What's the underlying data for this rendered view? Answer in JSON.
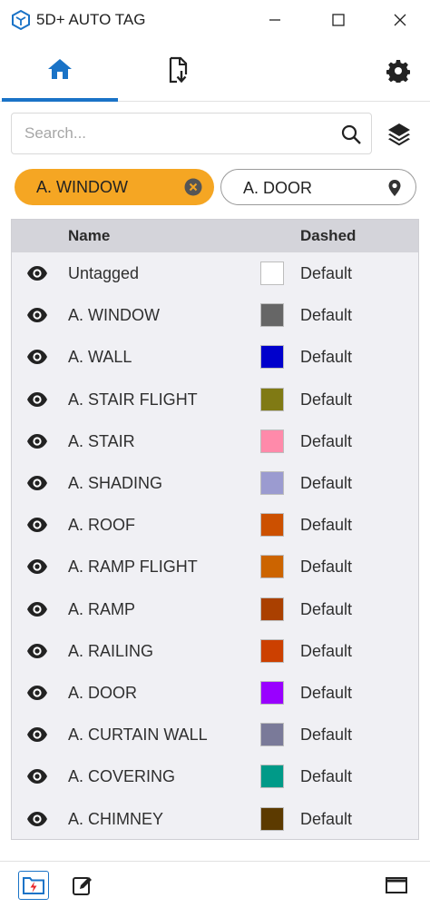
{
  "window": {
    "title": "5D+ AUTO TAG"
  },
  "nav": {
    "tabs": [
      {
        "icon": "home-icon",
        "active": true
      },
      {
        "icon": "import-file-icon",
        "active": false
      }
    ],
    "settings_icon": "gear-icon",
    "accent_color": "#1a73c7"
  },
  "search": {
    "placeholder": "Search...",
    "value": ""
  },
  "filters": {
    "chips": [
      {
        "label": "A. WINDOW",
        "selected": true,
        "color": "#f5a623",
        "icon": "close-circle-icon"
      },
      {
        "label": "A. DOOR",
        "selected": false,
        "color": "#ffffff",
        "icon": "location-pin-icon"
      }
    ]
  },
  "table": {
    "columns": {
      "visibility": "",
      "name": "Name",
      "color": "",
      "dashed": "Dashed"
    },
    "rows": [
      {
        "name": "Untagged",
        "color": "#ffffff",
        "dashed": "Default"
      },
      {
        "name": "A. WINDOW",
        "color": "#666666",
        "dashed": "Default"
      },
      {
        "name": "A. WALL",
        "color": "#0000cc",
        "dashed": "Default"
      },
      {
        "name": "A. STAIR FLIGHT",
        "color": "#807a14",
        "dashed": "Default"
      },
      {
        "name": "A. STAIR",
        "color": "#ff8aaa",
        "dashed": "Default"
      },
      {
        "name": "A. SHADING",
        "color": "#9b9bd0",
        "dashed": "Default"
      },
      {
        "name": "A. ROOF",
        "color": "#cc5000",
        "dashed": "Default"
      },
      {
        "name": "A. RAMP FLIGHT",
        "color": "#cc6400",
        "dashed": "Default"
      },
      {
        "name": "A. RAMP",
        "color": "#aa4000",
        "dashed": "Default"
      },
      {
        "name": "A. RAILING",
        "color": "#cc4000",
        "dashed": "Default"
      },
      {
        "name": "A. DOOR",
        "color": "#9900ff",
        "dashed": "Default"
      },
      {
        "name": "A. CURTAIN WALL",
        "color": "#7a7a99",
        "dashed": "Default"
      },
      {
        "name": "A. COVERING",
        "color": "#009a88",
        "dashed": "Default"
      },
      {
        "name": "A. CHIMNEY",
        "color": "#5c3a00",
        "dashed": "Default"
      }
    ]
  },
  "bottom_bar": {
    "icons": [
      "lightning-folder-icon",
      "edit-icon",
      "window-icon"
    ]
  }
}
